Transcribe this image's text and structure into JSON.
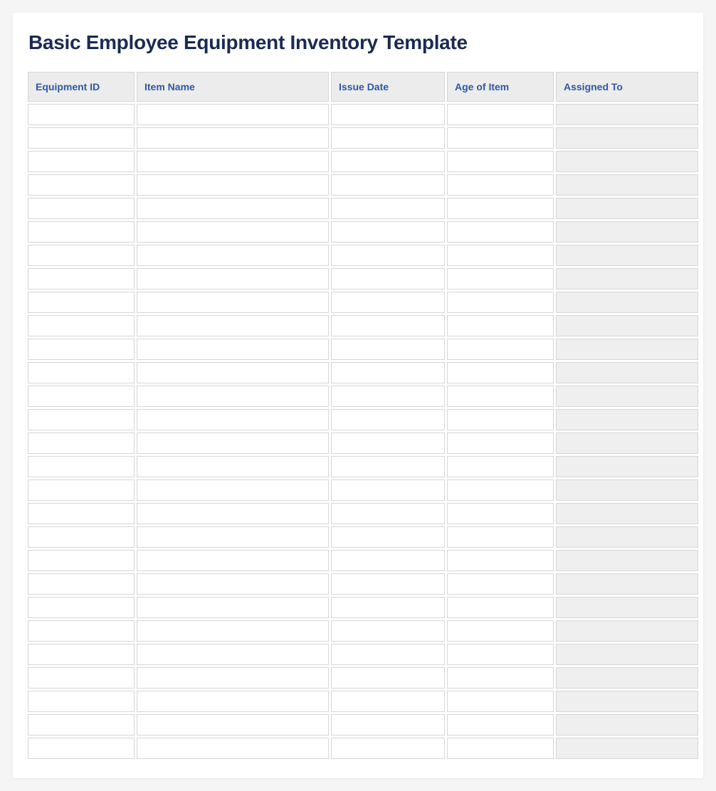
{
  "title": "Basic Employee Equipment Inventory Template",
  "columns": [
    {
      "key": "equipment_id",
      "label": "Equipment ID"
    },
    {
      "key": "item_name",
      "label": "Item Name"
    },
    {
      "key": "issue_date",
      "label": "Issue Date"
    },
    {
      "key": "age_of_item",
      "label": "Age of Item"
    },
    {
      "key": "assigned_to",
      "label": "Assigned To"
    }
  ],
  "row_count": 28,
  "rows": [
    {
      "equipment_id": "",
      "item_name": "",
      "issue_date": "",
      "age_of_item": "",
      "assigned_to": ""
    },
    {
      "equipment_id": "",
      "item_name": "",
      "issue_date": "",
      "age_of_item": "",
      "assigned_to": ""
    },
    {
      "equipment_id": "",
      "item_name": "",
      "issue_date": "",
      "age_of_item": "",
      "assigned_to": ""
    },
    {
      "equipment_id": "",
      "item_name": "",
      "issue_date": "",
      "age_of_item": "",
      "assigned_to": ""
    },
    {
      "equipment_id": "",
      "item_name": "",
      "issue_date": "",
      "age_of_item": "",
      "assigned_to": ""
    },
    {
      "equipment_id": "",
      "item_name": "",
      "issue_date": "",
      "age_of_item": "",
      "assigned_to": ""
    },
    {
      "equipment_id": "",
      "item_name": "",
      "issue_date": "",
      "age_of_item": "",
      "assigned_to": ""
    },
    {
      "equipment_id": "",
      "item_name": "",
      "issue_date": "",
      "age_of_item": "",
      "assigned_to": ""
    },
    {
      "equipment_id": "",
      "item_name": "",
      "issue_date": "",
      "age_of_item": "",
      "assigned_to": ""
    },
    {
      "equipment_id": "",
      "item_name": "",
      "issue_date": "",
      "age_of_item": "",
      "assigned_to": ""
    },
    {
      "equipment_id": "",
      "item_name": "",
      "issue_date": "",
      "age_of_item": "",
      "assigned_to": ""
    },
    {
      "equipment_id": "",
      "item_name": "",
      "issue_date": "",
      "age_of_item": "",
      "assigned_to": ""
    },
    {
      "equipment_id": "",
      "item_name": "",
      "issue_date": "",
      "age_of_item": "",
      "assigned_to": ""
    },
    {
      "equipment_id": "",
      "item_name": "",
      "issue_date": "",
      "age_of_item": "",
      "assigned_to": ""
    },
    {
      "equipment_id": "",
      "item_name": "",
      "issue_date": "",
      "age_of_item": "",
      "assigned_to": ""
    },
    {
      "equipment_id": "",
      "item_name": "",
      "issue_date": "",
      "age_of_item": "",
      "assigned_to": ""
    },
    {
      "equipment_id": "",
      "item_name": "",
      "issue_date": "",
      "age_of_item": "",
      "assigned_to": ""
    },
    {
      "equipment_id": "",
      "item_name": "",
      "issue_date": "",
      "age_of_item": "",
      "assigned_to": ""
    },
    {
      "equipment_id": "",
      "item_name": "",
      "issue_date": "",
      "age_of_item": "",
      "assigned_to": ""
    },
    {
      "equipment_id": "",
      "item_name": "",
      "issue_date": "",
      "age_of_item": "",
      "assigned_to": ""
    },
    {
      "equipment_id": "",
      "item_name": "",
      "issue_date": "",
      "age_of_item": "",
      "assigned_to": ""
    },
    {
      "equipment_id": "",
      "item_name": "",
      "issue_date": "",
      "age_of_item": "",
      "assigned_to": ""
    },
    {
      "equipment_id": "",
      "item_name": "",
      "issue_date": "",
      "age_of_item": "",
      "assigned_to": ""
    },
    {
      "equipment_id": "",
      "item_name": "",
      "issue_date": "",
      "age_of_item": "",
      "assigned_to": ""
    },
    {
      "equipment_id": "",
      "item_name": "",
      "issue_date": "",
      "age_of_item": "",
      "assigned_to": ""
    },
    {
      "equipment_id": "",
      "item_name": "",
      "issue_date": "",
      "age_of_item": "",
      "assigned_to": ""
    },
    {
      "equipment_id": "",
      "item_name": "",
      "issue_date": "",
      "age_of_item": "",
      "assigned_to": ""
    },
    {
      "equipment_id": "",
      "item_name": "",
      "issue_date": "",
      "age_of_item": "",
      "assigned_to": ""
    }
  ]
}
